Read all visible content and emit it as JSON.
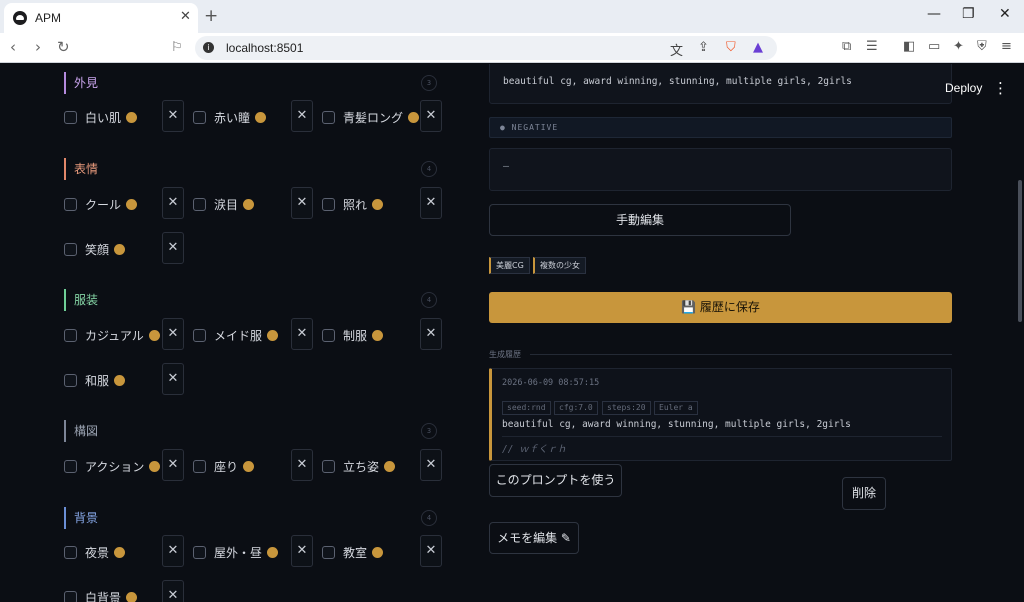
{
  "browser": {
    "tab_title": "APM",
    "tab_close": "✕",
    "new_tab": "+",
    "url": "localhost:8501",
    "window_min": "—",
    "window_max": "❐",
    "window_close": "✕"
  },
  "app": {
    "deploy_label": "Deploy",
    "menu_icon": "⋮"
  },
  "left": {
    "sections": [
      {
        "title": "外見",
        "count": "3",
        "color": "#b48ade"
      },
      {
        "title": "表情",
        "count": "4",
        "color": "#e2876a"
      },
      {
        "title": "服装",
        "count": "4",
        "color": "#6fcf97"
      },
      {
        "title": "構図",
        "count": "3",
        "color": "#7d8597"
      },
      {
        "title": "背景",
        "count": "4",
        "color": "#6b8fd6"
      }
    ],
    "items": {
      "shiroi_hada": "白い肌",
      "akai_hitomi": "赤い瞳",
      "aogami_long": "青髪ロング",
      "cool": "クール",
      "namida": "涙目",
      "tere": "照れ",
      "egao": "笑顔",
      "casual": "カジュアル",
      "maid": "メイド服",
      "seifuku": "制服",
      "wafuku": "和服",
      "action": "アクション",
      "suwari": "座り",
      "tachisugata": "立ち姿",
      "yakei": "夜景",
      "okugai": "屋外・昼",
      "kyoushitsu": "教室",
      "shirohaikei": "白背景"
    },
    "remove_glyph": "✕"
  },
  "right": {
    "positive_prompt": "beautiful cg, award winning, stunning, multiple girls, 2girls",
    "negative_label": "● NEGATIVE",
    "negative_value": "—",
    "manual_edit_button": "手動編集",
    "tags": [
      "美麗CG",
      "複数の少女"
    ],
    "save_button": "💾 履歴に保存",
    "history_label": "生成履歴",
    "history": {
      "timestamp": "2026-06-09 08:57:15",
      "params": [
        "seed:rnd",
        "cfg:7.0",
        "steps:20",
        "Euler a"
      ],
      "prompt": "beautiful cg, award winning, stunning, multiple girls, 2girls",
      "memo": "// ｗｆくｒｈ"
    },
    "use_prompt_button": "このプロンプトを使う",
    "delete_button": "削除",
    "edit_memo_button": "メモを編集 ✎"
  }
}
